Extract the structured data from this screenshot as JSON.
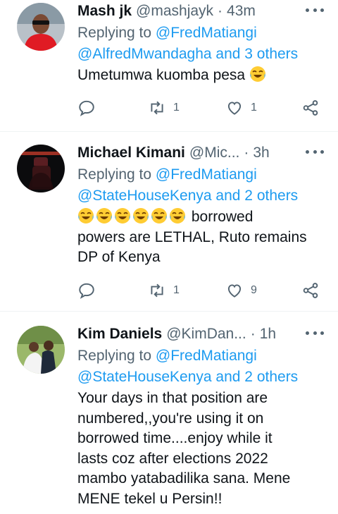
{
  "tweets": [
    {
      "name": "Mash jk",
      "handle": "@mashjayk",
      "time": "43m",
      "replying_prefix": "Replying to",
      "replying_line1": "@FredMatiangi",
      "replying_line2": "@AlfredMwandagha and 3 others",
      "text_lines": [
        "Umetumwa kuomba pesa"
      ],
      "emoji_count": 1,
      "replies": "",
      "retweets": "1",
      "likes": "1"
    },
    {
      "name": "Michael Kimani",
      "handle": "@Mic...",
      "time": "3h",
      "replying_prefix": "Replying to",
      "replying_line1": "@FredMatiangi",
      "replying_line2": "@StateHouseKenya and 2 others",
      "text_lines": [
        "borrowed",
        "powers are LETHAL, Ruto remains",
        "DP of Kenya"
      ],
      "emoji_count": 6,
      "replies": "",
      "retweets": "1",
      "likes": "9"
    },
    {
      "name": "Kim Daniels",
      "handle": "@KimDan...",
      "time": "1h",
      "replying_prefix": "Replying to",
      "replying_line1": "@FredMatiangi",
      "replying_line2": "@StateHouseKenya and 2 others",
      "text_lines": [
        "Your days in that position are",
        "numbered,,you're using it on",
        "borrowed time....enjoy while it",
        "lasts coz after elections 2022",
        "mambo yatabadilika sana. Mene",
        "MENE tekel u Persin!!"
      ],
      "emoji_count": 0
    }
  ],
  "colors": {
    "link": "#1d9bf0",
    "secondary": "#536471",
    "text": "#0f1419"
  }
}
